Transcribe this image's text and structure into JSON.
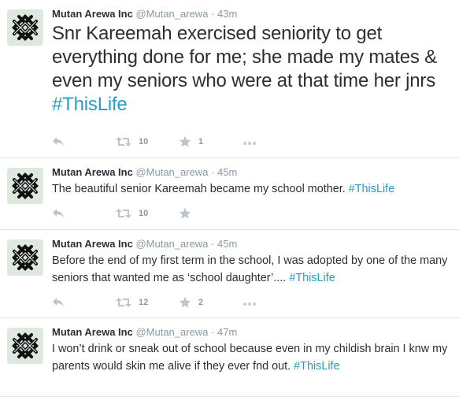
{
  "colors": {
    "hashtag": "#2b9bc1",
    "meta": "#8899a6",
    "action_icon": "#bac5cd",
    "avatar_bg": "#dfe8de"
  },
  "icons": {
    "avatar": "knot-logo-icon",
    "reply": "reply-icon",
    "retweet": "retweet-icon",
    "favorite": "star-icon",
    "more": "more-dots-icon"
  },
  "tweets": [
    {
      "name": "Mutan Arewa Inc",
      "handle": "@Mutan_arewa",
      "separator": "·",
      "time": "43m",
      "text": "Snr Kareemah exercised seniority to get everything done for me; she made my mates & even my seniors who were at that time her jnrs ",
      "hashtag": "#ThisLife",
      "retweets": "10",
      "favorites": "1"
    },
    {
      "name": "Mutan Arewa Inc",
      "handle": "@Mutan_arewa",
      "separator": "·",
      "time": "45m",
      "text": "The beautiful senior Kareemah became my school mother. ",
      "hashtag": "#ThisLife",
      "retweets": "10",
      "favorites": ""
    },
    {
      "name": "Mutan Arewa Inc",
      "handle": "@Mutan_arewa",
      "separator": "·",
      "time": "45m",
      "text": "Before the end of my first term in the school, I was adopted by one of the many seniors that wanted me as ‘school daughter’.... ",
      "hashtag": "#ThisLife",
      "retweets": "12",
      "favorites": "2"
    },
    {
      "name": "Mutan Arewa Inc",
      "handle": "@Mutan_arewa",
      "separator": "·",
      "time": "47m",
      "text": "I won’t drink or sneak out of school because even in my childish brain I knw my parents would skin me alive if they ever fnd out. ",
      "hashtag": "#ThisLife",
      "retweets": "",
      "favorites": ""
    }
  ]
}
